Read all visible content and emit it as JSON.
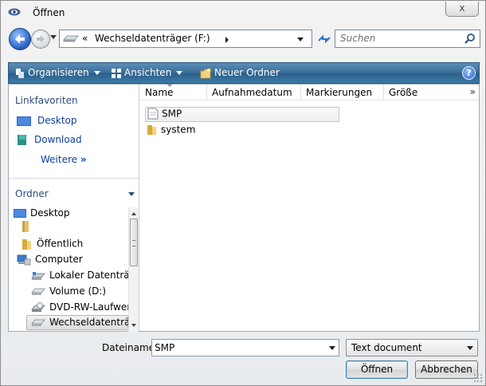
{
  "window": {
    "title": "Öffnen",
    "close_label": "x"
  },
  "nav": {
    "address_chevron": "«",
    "address_text": "Wechseldatenträger (F:)",
    "search_placeholder": "Suchen"
  },
  "toolbar": {
    "organize_label": "Organisieren",
    "views_label": "Ansichten",
    "new_folder_label": "Neuer Ordner",
    "help_label": "?"
  },
  "favorites": {
    "heading": "Linkfavoriten",
    "items": [
      {
        "label": "Desktop",
        "icon": "desktop-icon"
      },
      {
        "label": "Download",
        "icon": "download-icon"
      }
    ],
    "more_label": "Weitere",
    "more_chevron": "»"
  },
  "folders": {
    "heading": "Ordner",
    "tree": [
      {
        "label": "Desktop",
        "icon": "desktop-icon"
      },
      {
        "label": "",
        "icon": "user-folder-icon"
      },
      {
        "label": "Öffentlich",
        "icon": "folder-icon"
      },
      {
        "label": "Computer",
        "icon": "computer-icon"
      },
      {
        "label": "Lokaler Datenträg",
        "icon": "local-drive-icon"
      },
      {
        "label": "Volume (D:)",
        "icon": "drive-icon"
      },
      {
        "label": "DVD-RW-Laufwer",
        "icon": "dvd-drive-icon"
      },
      {
        "label": "Wechseldatenträg",
        "icon": "removable-drive-icon",
        "selected": true
      }
    ]
  },
  "columns": {
    "name": "Name",
    "date": "Aufnahmedatum",
    "tags": "Markierungen",
    "size": "Größe",
    "more": "»"
  },
  "files": [
    {
      "name": "SMP",
      "icon": "text-document-icon",
      "selected": true
    },
    {
      "name": "system",
      "icon": "folder-icon",
      "selected": false
    }
  ],
  "bottom": {
    "filename_label": "Dateiname:",
    "filename_value": "SMP",
    "filetype_value": "Text document",
    "open_label": "Öffnen",
    "cancel_label": "Abbrechen"
  },
  "colors": {
    "toolbar_blue": "#3c6f98",
    "link_blue": "#0b3e9e",
    "heading_blue": "#2a4a80"
  }
}
